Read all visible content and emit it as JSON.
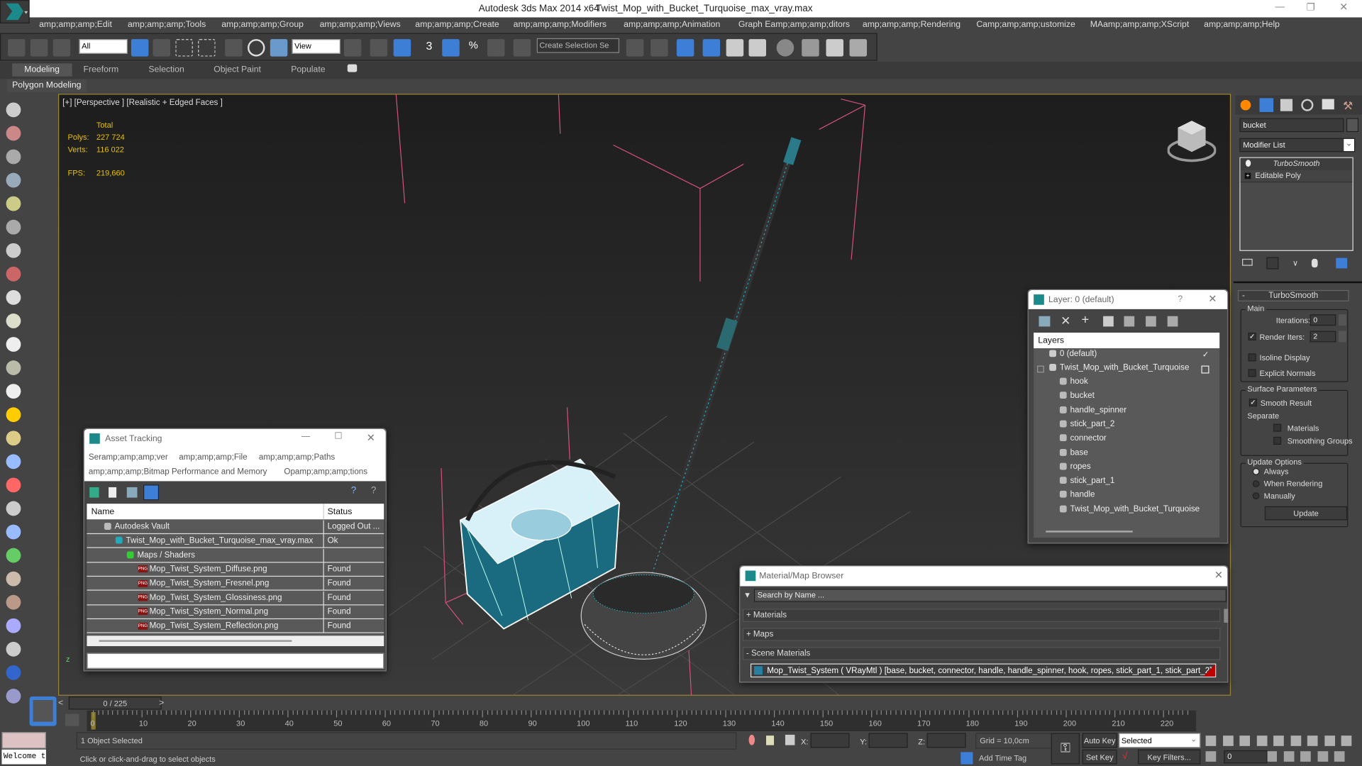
{
  "window": {
    "app_title": "Autodesk 3ds Max  2014 x64",
    "file_title": "Twist_Mop_with_Bucket_Turquoise_max_vray.max"
  },
  "menu": [
    "amp;amp;amp;Edit",
    "amp;amp;amp;Tools",
    "amp;amp;amp;Group",
    "amp;amp;amp;Views",
    "amp;amp;amp;Create",
    "amp;amp;amp;Modifiers",
    "amp;amp;amp;Animation",
    "Graph Eamp;amp;amp;ditors",
    "amp;amp;amp;Rendering",
    "Camp;amp;amp;ustomize",
    "MAamp;amp;amp;XScript",
    "amp;amp;amp;Help"
  ],
  "toolbar": {
    "selection_filter": "All",
    "reference_coord": "View",
    "named_selection": "Create Selection Se",
    "snap_label": "3"
  },
  "ribbon": {
    "tabs": [
      "Modeling",
      "Freeform",
      "Selection",
      "Object Paint",
      "Populate"
    ],
    "active": "Modeling",
    "sub": "Polygon Modeling"
  },
  "viewport": {
    "label": "[+] [Perspective ] [Realistic + Edged Faces ]",
    "stats": {
      "header": "Total",
      "polys_label": "Polys:",
      "polys": "227 724",
      "verts_label": "Verts:",
      "verts": "116 022",
      "fps_label": "FPS:",
      "fps": "219,660"
    }
  },
  "command_panel": {
    "object_name": "bucket",
    "modifier_list": "Modifier List",
    "stack": [
      "TurboSmooth",
      "Editable Poly"
    ],
    "rollout": "TurboSmooth",
    "main_group": "Main",
    "iterations_label": "Iterations:",
    "iterations": "0",
    "render_iters_label": "Render Iters:",
    "render_iters": "2",
    "render_iters_checked": true,
    "isoline": "Isoline Display",
    "explicit_normals": "Explicit Normals",
    "surface_group": "Surface Parameters",
    "smooth_result": "Smooth Result",
    "separate": "Separate",
    "materials": "Materials",
    "smoothing_groups": "Smoothing Groups",
    "update_group": "Update Options",
    "always": "Always",
    "when_rendering": "When Rendering",
    "manually": "Manually",
    "update_button": "Update"
  },
  "asset_tracking": {
    "title": "Asset Tracking",
    "menu": [
      "Seramp;amp;amp;ver",
      "amp;amp;amp;File",
      "amp;amp;amp;Paths",
      "amp;amp;amp;Bitmap Performance and Memory",
      "Opamp;amp;amp;tions"
    ],
    "columns": [
      "Name",
      "Status"
    ],
    "rows": [
      {
        "name": "Autodesk Vault",
        "status": "Logged Out ..."
      },
      {
        "name": "Twist_Mop_with_Bucket_Turquoise_max_vray.max",
        "status": "Ok"
      },
      {
        "name": "Maps / Shaders",
        "status": ""
      },
      {
        "name": "Mop_Twist_System_Diffuse.png",
        "status": "Found"
      },
      {
        "name": "Mop_Twist_System_Fresnel.png",
        "status": "Found"
      },
      {
        "name": "Mop_Twist_System_Glossiness.png",
        "status": "Found"
      },
      {
        "name": "Mop_Twist_System_Normal.png",
        "status": "Found"
      },
      {
        "name": "Mop_Twist_System_Reflection.png",
        "status": "Found"
      }
    ],
    "png_badge": "PNG"
  },
  "layer_dialog": {
    "title": "Layer: 0 (default)",
    "help": "?",
    "header": "Layers",
    "layers": [
      "0 (default)",
      "Twist_Mop_with_Bucket_Turquoise"
    ],
    "objects": [
      "hook",
      "bucket",
      "handle_spinner",
      "stick_part_2",
      "connector",
      "base",
      "ropes",
      "stick_part_1",
      "handle",
      "Twist_Mop_with_Bucket_Turquoise"
    ]
  },
  "material_browser": {
    "title": "Material/Map Browser",
    "search_placeholder": "Search by Name ...",
    "sections": [
      "+ Materials",
      "+ Maps",
      "- Scene Materials"
    ],
    "material": "Mop_Twist_System ( VRayMtl ) [base, bucket, connector, handle, handle_spinner, hook, ropes, stick_part_1, stick_part_2]"
  },
  "timeline": {
    "frame": "0 / 225",
    "prev": "<",
    "next": ">",
    "ticks": [
      "0",
      "10",
      "20",
      "30",
      "40",
      "50",
      "60",
      "70",
      "80",
      "90",
      "100",
      "110",
      "120",
      "130",
      "140",
      "150",
      "160",
      "170",
      "180",
      "190",
      "200",
      "210",
      "220"
    ]
  },
  "status": {
    "maxscript": "Welcome to M",
    "selected": "1 Object Selected",
    "prompt": "Click or click-and-drag to select objects",
    "x_label": "X:",
    "y_label": "Y:",
    "z_label": "Z:",
    "grid": "Grid = 10,0cm",
    "add_time_tag": "Add Time Tag",
    "auto_key": "Auto Key",
    "set_key": "Set Key",
    "key_mode": "Selected",
    "key_filters": "Key Filters...",
    "current_frame": "0"
  },
  "colors": {
    "accent": "#3d7fd6",
    "viewport_border": "#9a8434",
    "stats": "#e8c000",
    "mesh": "#2aa8c0",
    "material_flag": "#c00000"
  }
}
